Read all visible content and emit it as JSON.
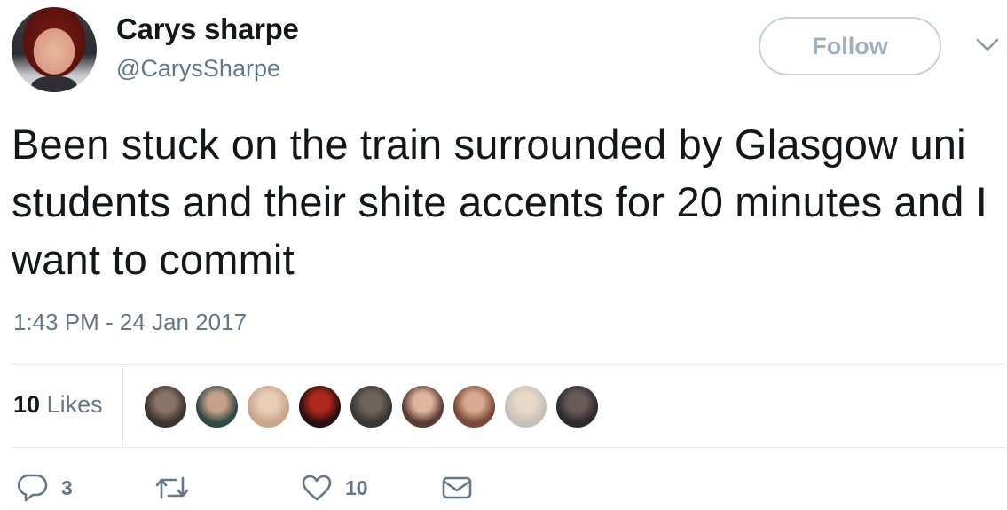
{
  "user": {
    "display_name": "Carys sharpe",
    "handle": "@CarysSharpe"
  },
  "follow_label": "Follow",
  "tweet": {
    "text": "Been stuck on the train surrounded by Glasgow uni students and their shite accents for 20 minutes and I want to commit",
    "timestamp": "1:43 PM - 24 Jan 2017"
  },
  "stats": {
    "likes_count": "10",
    "likes_label": "Likes"
  },
  "likers": [
    {
      "name": "liker-avatar-1",
      "colors": [
        "#3b3330",
        "#8a7468"
      ]
    },
    {
      "name": "liker-avatar-2",
      "colors": [
        "#2f4a45",
        "#c7a08a"
      ]
    },
    {
      "name": "liker-avatar-3",
      "colors": [
        "#c9a58c",
        "#e8cdb8"
      ]
    },
    {
      "name": "liker-avatar-4",
      "colors": [
        "#2a0f0f",
        "#b0281e"
      ]
    },
    {
      "name": "liker-avatar-5",
      "colors": [
        "#3a3633",
        "#6e645c"
      ]
    },
    {
      "name": "liker-avatar-6",
      "colors": [
        "#5a3a32",
        "#e0b5a0"
      ]
    },
    {
      "name": "liker-avatar-7",
      "colors": [
        "#7a4a38",
        "#d8a890"
      ]
    },
    {
      "name": "liker-avatar-8",
      "colors": [
        "#c8c0b8",
        "#e8d8c8"
      ]
    },
    {
      "name": "liker-avatar-9",
      "colors": [
        "#2c2a2e",
        "#6a5a58"
      ]
    }
  ],
  "actions": {
    "reply_count": "3",
    "retweet_count": "",
    "like_count": "10"
  },
  "icons": {
    "reply": "reply-icon",
    "retweet": "retweet-icon",
    "like": "heart-icon",
    "message": "envelope-icon",
    "more": "chevron-down-icon"
  },
  "colors": {
    "text": "#14171a",
    "secondary": "#657786",
    "border": "#e1e8ed",
    "follow_border": "#c6d2db"
  }
}
